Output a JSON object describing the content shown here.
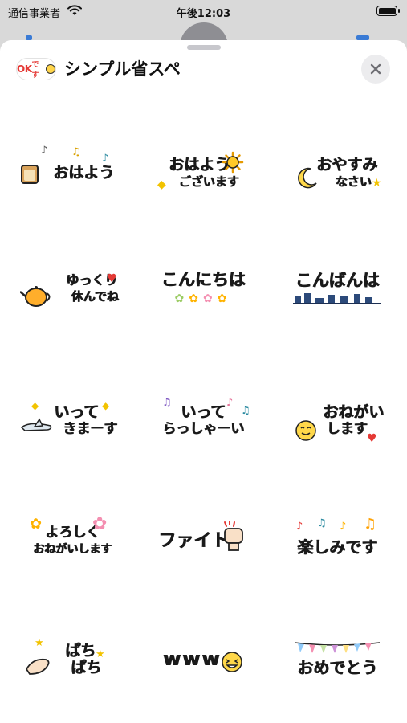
{
  "status_bar": {
    "carrier": "通信事業者",
    "time": "午後12:03"
  },
  "sheet": {
    "pack_icon_text": "OK",
    "pack_icon_suffix": "です",
    "title": "シンプル省スペ",
    "close_icon": "close-icon"
  },
  "stickers": [
    {
      "line1": "おはよう",
      "line2": ""
    },
    {
      "line1": "おはよう",
      "line2": "ございます"
    },
    {
      "line1": "おやすみ",
      "line2": "なさい"
    },
    {
      "line1": "ゆっくり",
      "line2": "休んでね"
    },
    {
      "line1": "こんにちは",
      "line2": ""
    },
    {
      "line1": "こんばんは",
      "line2": ""
    },
    {
      "line1": "いって",
      "line2": "きまーす"
    },
    {
      "line1": "いって",
      "line2": "らっしゃーい"
    },
    {
      "line1": "おねがい",
      "line2": "します"
    },
    {
      "line1": "よろしく",
      "line2": "おねがいします"
    },
    {
      "line1": "ファイト",
      "line2": ""
    },
    {
      "line1": "楽しみです",
      "line2": ""
    },
    {
      "line1": "ぱち",
      "line2": "ぱち"
    },
    {
      "line1": "www",
      "line2": ""
    },
    {
      "line1": "おめでとう",
      "line2": ""
    }
  ]
}
